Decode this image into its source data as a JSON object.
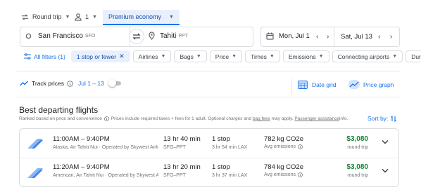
{
  "search": {
    "trip_type": "Round trip",
    "passengers": "1",
    "cabin_class": "Premium economy",
    "origin": {
      "city": "San Francisco",
      "code": "SFO"
    },
    "destination": {
      "city": "Tahiti",
      "code": "PPT"
    },
    "depart_date": "Mon, Jul 1",
    "return_date": "Sat, Jul 13"
  },
  "filters": {
    "all_filters": "All filters (1)",
    "stops": "1 stop or fewer",
    "chips": [
      "Airlines",
      "Bags",
      "Price",
      "Times",
      "Emissions",
      "Connecting airports",
      "Duratio"
    ]
  },
  "track": {
    "label": "Track prices",
    "dates": "Jul 1 – 13",
    "date_grid": "Date grid",
    "price_graph": "Price graph"
  },
  "results": {
    "heading": "Best departing flights",
    "ranked_note": "Ranked based on price and convenience",
    "fees_note_pre": "Prices include required taxes + fees for 1 adult. Optional charges and ",
    "bag_fees": "bag fees",
    "fees_note_mid": " may apply. ",
    "passenger_assistance": "Passenger assistance",
    "fees_note_post": " info.",
    "sort_label": "Sort by:",
    "flights": [
      {
        "times": "11:00AM – 9:40PM",
        "airline": "Alaska, Air Tahiti Nui · Operated by Skywest Airlin...",
        "duration": "13 hr 40 min",
        "route": "SFO–PPT",
        "stops": "1 stop",
        "layover": "3 hr 54 min LAX",
        "emissions": "782 kg CO2e",
        "emissions_label": "Avg emissions",
        "price": "$3,080",
        "price_label": "round trip"
      },
      {
        "times": "11:20AM – 9:40PM",
        "airline": "American, Air Tahiti Nui · Operated by Skywest Airli...",
        "duration": "13 hr 20 min",
        "route": "SFO–PPT",
        "stops": "1 stop",
        "layover": "3 hr 37 min LAX",
        "emissions": "784 kg CO2e",
        "emissions_label": "Avg emissions",
        "price": "$3,080",
        "price_label": "round trip"
      }
    ]
  }
}
